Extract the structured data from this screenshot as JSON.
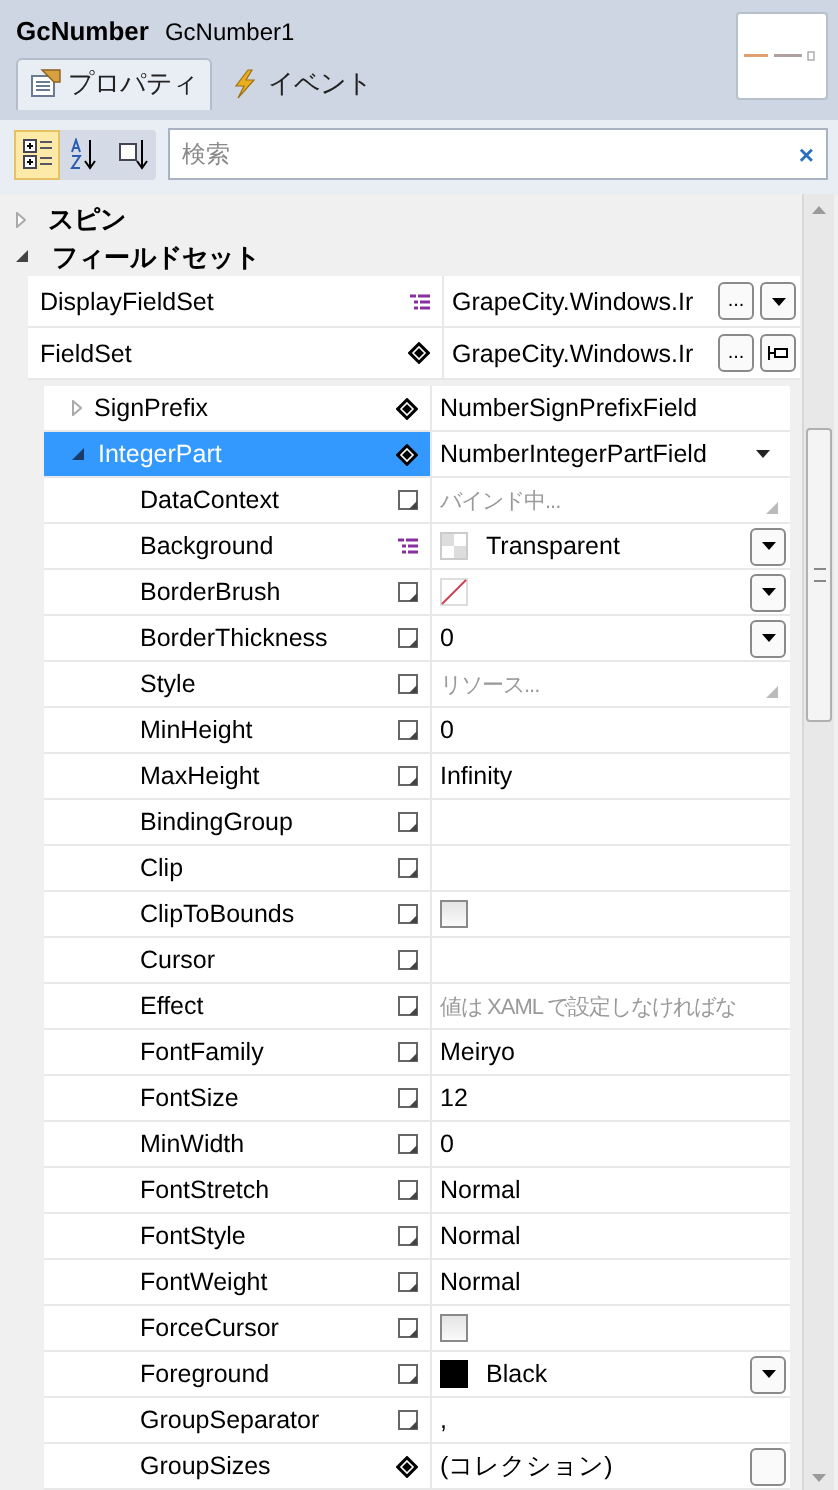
{
  "header": {
    "type": "GcNumber",
    "name": "GcNumber1"
  },
  "tabs": [
    {
      "label": "プロパティ",
      "selected": true
    },
    {
      "label": "イベント",
      "selected": false
    }
  ],
  "toolbar": [
    {
      "kind": "categorized",
      "selected": true
    },
    {
      "kind": "alphabetical",
      "selected": false
    },
    {
      "kind": "source",
      "selected": false
    }
  ],
  "search": {
    "placeholder": "検索",
    "clear": "×"
  },
  "categories": [
    {
      "label": "スピン",
      "expanded": false
    },
    {
      "label": "フィールドセット",
      "expanded": true,
      "properties": [
        {
          "name": "DisplayFieldSet",
          "resource": true,
          "value": "GrapeCity.Windows.Ir",
          "kind": "text",
          "buttons": [
            {
              "kind": "ellipsis",
              "label": "..."
            },
            {
              "kind": "dropdown"
            }
          ],
          "selected": false
        },
        {
          "name": "FieldSet",
          "local": true,
          "value": "GrapeCity.Windows.Ir",
          "kind": "text",
          "buttons": [
            {
              "kind": "ellipsis",
              "label": "..."
            },
            {
              "kind": "pin"
            }
          ],
          "selected": false,
          "children": [
            {
              "name": "SignPrefix",
              "local": true,
              "value": "NumberSignPrefixField",
              "kind": "text",
              "expanded": false,
              "selected": false
            },
            {
              "name": "IntegerPart",
              "local": true,
              "value": "NumberIntegerPartField",
              "kind": "text",
              "caret": true,
              "expanded": true,
              "selected": true,
              "children": [
                {
                  "name": "DataContext",
                  "placeholder": "バインド中...",
                  "kind": "text",
                  "grip": true,
                  "selected": false
                },
                {
                  "name": "Background",
                  "resource": true,
                  "value": "Transparent",
                  "kind": "transparent",
                  "buttons": [
                    {
                      "kind": "dropdown"
                    }
                  ],
                  "selected": false
                },
                {
                  "name": "BorderBrush",
                  "kind": "nobrush",
                  "buttons": [
                    {
                      "kind": "dropdown"
                    }
                  ],
                  "selected": false
                },
                {
                  "name": "BorderThickness",
                  "value": "0",
                  "kind": "text",
                  "buttons": [
                    {
                      "kind": "dropdown"
                    }
                  ],
                  "selected": false
                },
                {
                  "name": "Style",
                  "placeholder": "リソース...",
                  "kind": "text",
                  "grip": true,
                  "selected": false
                },
                {
                  "name": "MinHeight",
                  "value": "0",
                  "kind": "text",
                  "selected": false
                },
                {
                  "name": "MaxHeight",
                  "value": "Infinity",
                  "kind": "text",
                  "selected": false
                },
                {
                  "name": "BindingGroup",
                  "kind": "text",
                  "selected": false
                },
                {
                  "name": "Clip",
                  "kind": "text",
                  "selected": false
                },
                {
                  "name": "ClipToBounds",
                  "kind": "checkbox",
                  "checked": false,
                  "selected": false
                },
                {
                  "name": "Cursor",
                  "kind": "text",
                  "selected": false
                },
                {
                  "name": "Effect",
                  "placeholder": "値は XAML で設定しなければな",
                  "kind": "text",
                  "selected": false
                },
                {
                  "name": "FontFamily",
                  "value": "Meiryo",
                  "kind": "text",
                  "selected": false
                },
                {
                  "name": "FontSize",
                  "value": "12",
                  "kind": "text",
                  "selected": false
                },
                {
                  "name": "MinWidth",
                  "value": "0",
                  "kind": "text",
                  "selected": false
                },
                {
                  "name": "FontStretch",
                  "value": "Normal",
                  "kind": "text",
                  "selected": false
                },
                {
                  "name": "FontStyle",
                  "value": "Normal",
                  "kind": "text",
                  "selected": false
                },
                {
                  "name": "FontWeight",
                  "value": "Normal",
                  "kind": "text",
                  "selected": false
                },
                {
                  "name": "ForceCursor",
                  "kind": "checkbox",
                  "checked": false,
                  "selected": false
                },
                {
                  "name": "Foreground",
                  "value": "Black",
                  "kind": "color",
                  "color": "#000000",
                  "buttons": [
                    {
                      "kind": "dropdown"
                    }
                  ],
                  "selected": false
                },
                {
                  "name": "GroupSeparator",
                  "value": ",",
                  "kind": "text",
                  "selected": false
                },
                {
                  "name": "GroupSizes",
                  "local": true,
                  "value": "(コレクション)",
                  "kind": "text",
                  "buttons": [
                    {
                      "kind": "blank"
                    }
                  ],
                  "selected": false
                }
              ]
            }
          ]
        }
      ]
    }
  ]
}
